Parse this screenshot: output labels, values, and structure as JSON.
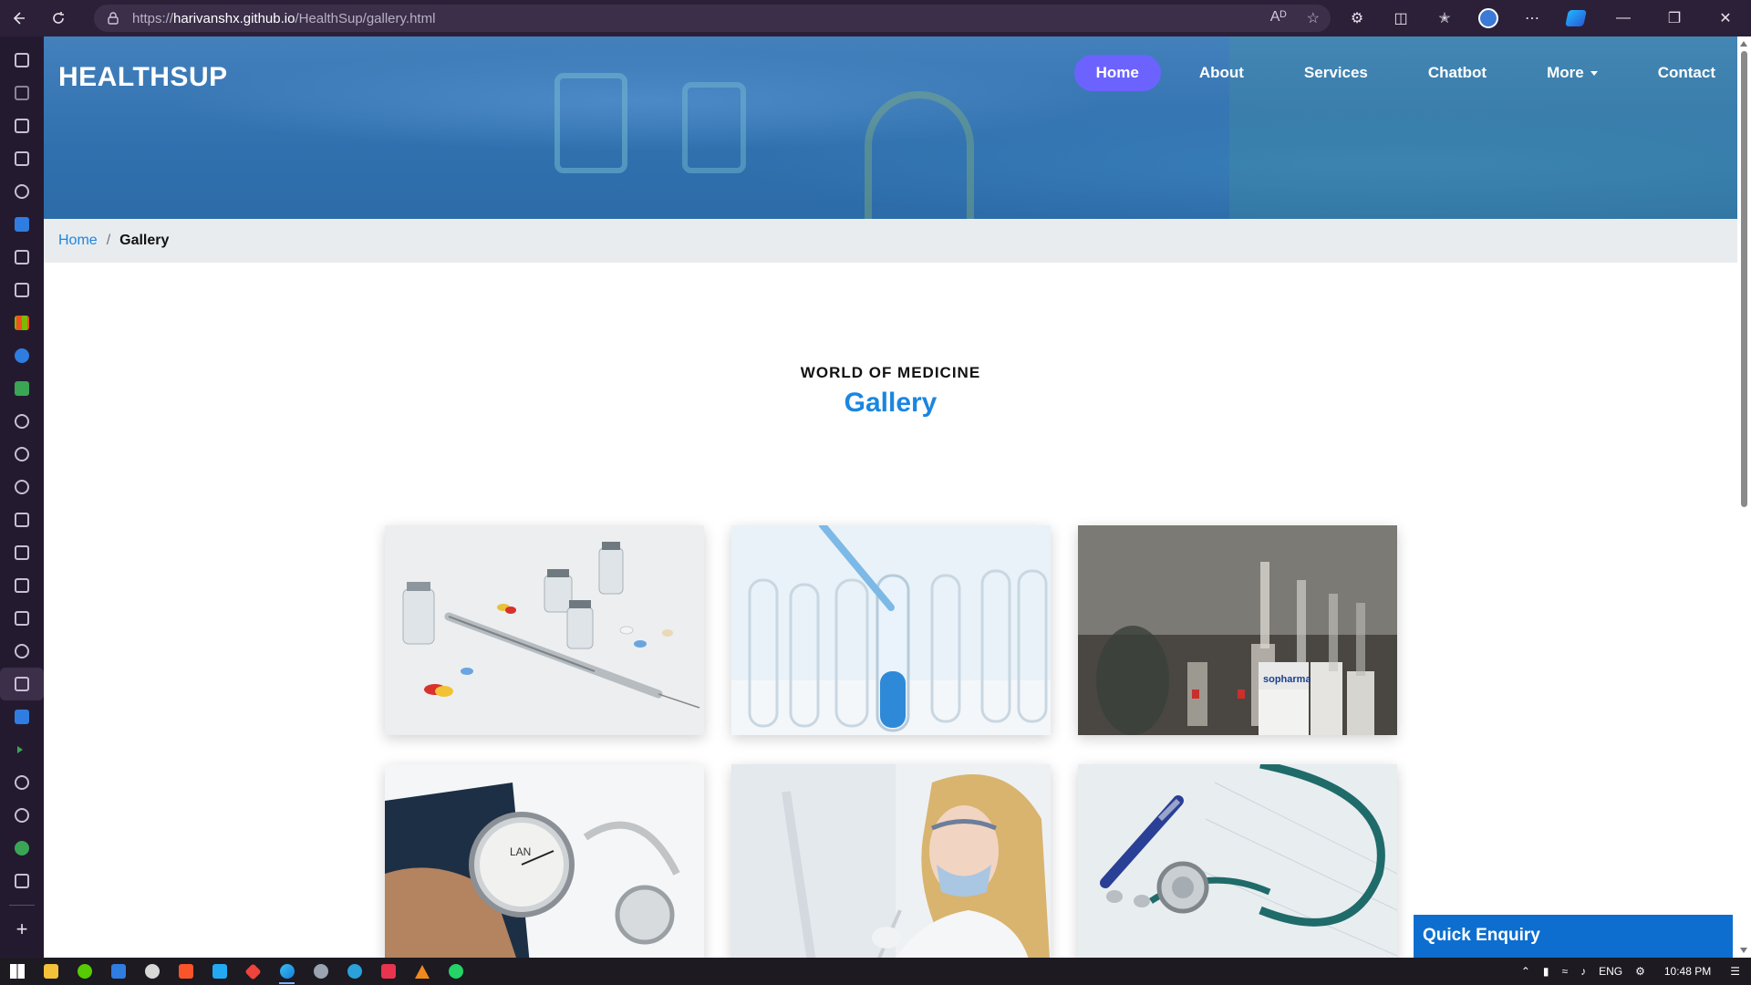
{
  "browser": {
    "url_prefix": "https://",
    "url_host": "harivanshx.github.io",
    "url_path": "/HealthSup/gallery.html",
    "back_icon": "arrow-left-icon",
    "refresh_icon": "refresh-icon"
  },
  "site": {
    "brand": "HEALTHSUP",
    "nav": [
      {
        "label": "Home",
        "active": true
      },
      {
        "label": "About"
      },
      {
        "label": "Services"
      },
      {
        "label": "Chatbot"
      },
      {
        "label": "More"
      },
      {
        "label": "Contact"
      }
    ],
    "accent_color": "#6c63ff",
    "link_color": "#1a86e0"
  },
  "breadcrumb": {
    "home": "Home",
    "separator": "/",
    "current": "Gallery"
  },
  "section": {
    "kicker": "WORLD OF MEDICINE",
    "title": "Gallery"
  },
  "gallery": {
    "images": [
      "syringe-vials-pills",
      "test-tubes-blue-liquid",
      "medicine-ampoules",
      "blood-pressure-gauge",
      "lab-scientist",
      "stethoscope-pen"
    ]
  },
  "enquiry": {
    "label": "Quick Enquiry"
  },
  "taskbar": {
    "language": "ENG",
    "time": "10:48 PM"
  }
}
